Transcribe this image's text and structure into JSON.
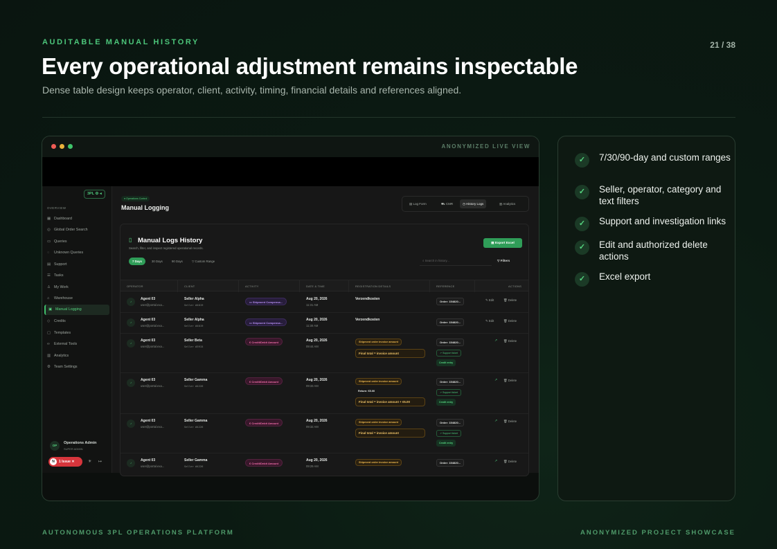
{
  "slide": {
    "eyebrow": "AUDITABLE MANUAL HISTORY",
    "page": "21 / 38",
    "title": "Every operational adjustment remains inspectable",
    "subtitle": "Dense table design keeps operator, client, activity, timing, financial details and references aligned.",
    "footer_left": "AUTONOMOUS 3PL OPERATIONS PLATFORM",
    "footer_right": "ANONYMIZED PROJECT SHOWCASE",
    "accent": "#4cc57a"
  },
  "window": {
    "tag": "ANONYMIZED LIVE VIEW"
  },
  "sidebar": {
    "logo": "3PL",
    "section": "OVERVIEW",
    "items": [
      {
        "label": "Dashboard",
        "icon": "grid-icon"
      },
      {
        "label": "Global Order Search",
        "icon": "globe-icon"
      },
      {
        "label": "Queries",
        "icon": "chat-icon"
      },
      {
        "label": "Unknown Queries",
        "icon": "help-icon"
      },
      {
        "label": "Support",
        "icon": "inbox-icon"
      },
      {
        "label": "Tasks",
        "icon": "checklist-icon"
      },
      {
        "label": "My Work",
        "icon": "user-icon"
      },
      {
        "label": "Warehouse",
        "icon": "warehouse-icon"
      },
      {
        "label": "Manual Logging",
        "icon": "log-icon"
      },
      {
        "label": "Credits",
        "icon": "tag-icon"
      },
      {
        "label": "Templates",
        "icon": "template-icon"
      },
      {
        "label": "External Tools",
        "icon": "link-icon"
      },
      {
        "label": "Analytics",
        "icon": "chart-icon"
      },
      {
        "label": "Team Settings",
        "icon": "gear-icon"
      }
    ],
    "user": {
      "initials": "OP",
      "name": "Operations Admin",
      "role": "SUPER ADMIN"
    },
    "issue": {
      "n": "N",
      "label": "1 Issue"
    }
  },
  "main": {
    "pill": "Operations Control",
    "title": "Manual Logging",
    "tabs": [
      "Log Form",
      "CMR",
      "History Logs",
      "Analytics"
    ],
    "card": {
      "title": "Manual Logs History",
      "subtitle": "Search, filter, and inspect registered operational records.",
      "export": "Export Excel",
      "ranges": [
        "7 Days",
        "30 Days",
        "90 Days",
        "Custom Range"
      ],
      "search_placeholder": "Search in history...",
      "filters": "Filters",
      "columns": [
        "OPERATOR",
        "CLIENT",
        "ACTIVITY",
        "DATE & TIME",
        "REGISTRATION DETAILS",
        "REFERENCE",
        "ACTIONS"
      ]
    },
    "rows": [
      {
        "agent": "Agent 03",
        "email": "user@portal.exa...",
        "client": "Seller Alpha",
        "client_id": "Seller #4019",
        "activity": "Shipment Compensa...",
        "date": "Aug 20, 2026",
        "time": "11:31 AM",
        "reg": "Verzendkosten",
        "ref": "Order: 154820..."
      },
      {
        "agent": "Agent 03",
        "email": "user@portal.exa...",
        "client": "Seller Alpha",
        "client_id": "Seller #4019",
        "activity": "Shipment Compensa...",
        "date": "Aug 20, 2026",
        "time": "11:30 AM",
        "reg": "Verzendkosten",
        "ref": "Order: 154820..."
      },
      {
        "agent": "Agent 03",
        "email": "user@portal.exa...",
        "client": "Seller Beta",
        "client_id": "Seller #3915",
        "activity": "Credit/Debit Amount",
        "date": "Aug 20, 2026",
        "time": "09:44 AM",
        "reg_tag": "Shipment order invoice amount",
        "reg_total": "Final total = invoice amount",
        "ref": "Order: 154820...",
        "ref_link": "Support ticket",
        "ref_credit": "Credit entry"
      },
      {
        "agent": "Agent 03",
        "email": "user@portal.exa...",
        "client": "Seller Gamma",
        "client_id": "Seller #4226",
        "activity": "Credit/Debit Amount",
        "date": "Aug 20, 2026",
        "time": "09:33 AM",
        "reg_tag": "Shipment order invoice amount",
        "reg_ret": "Return: €5.00",
        "reg_total": "Final total = invoice amount + €5.00",
        "ref": "Order: 154820...",
        "ref_link": "Support ticket",
        "ref_credit": "Credit entry"
      },
      {
        "agent": "Agent 03",
        "email": "user@portal.exa...",
        "client": "Seller Gamma",
        "client_id": "Seller #4226",
        "activity": "Credit/Debit Amount",
        "date": "Aug 20, 2026",
        "time": "09:32 AM",
        "reg_tag": "Shipment order invoice amount",
        "reg_total": "Final total = invoice amount",
        "ref": "Order: 154820...",
        "ref_link": "Support ticket",
        "ref_credit": "Credit entry"
      },
      {
        "agent": "Agent 03",
        "email": "user@portal.exa...",
        "client": "Seller Gamma",
        "client_id": "Seller #4226",
        "activity": "Credit/Debit Amount",
        "date": "Aug 20, 2026",
        "time": "09:29 AM",
        "reg_tag": "Shipment order invoice amount",
        "ref": "Order: 154820..."
      }
    ],
    "actions": {
      "edit": "Edit",
      "delete": "Delete"
    }
  },
  "features": [
    "7/30/90-day and custom ranges",
    "Seller, operator, category and text filters",
    "Support and investigation links",
    "Edit and authorized delete actions",
    "Excel export"
  ]
}
